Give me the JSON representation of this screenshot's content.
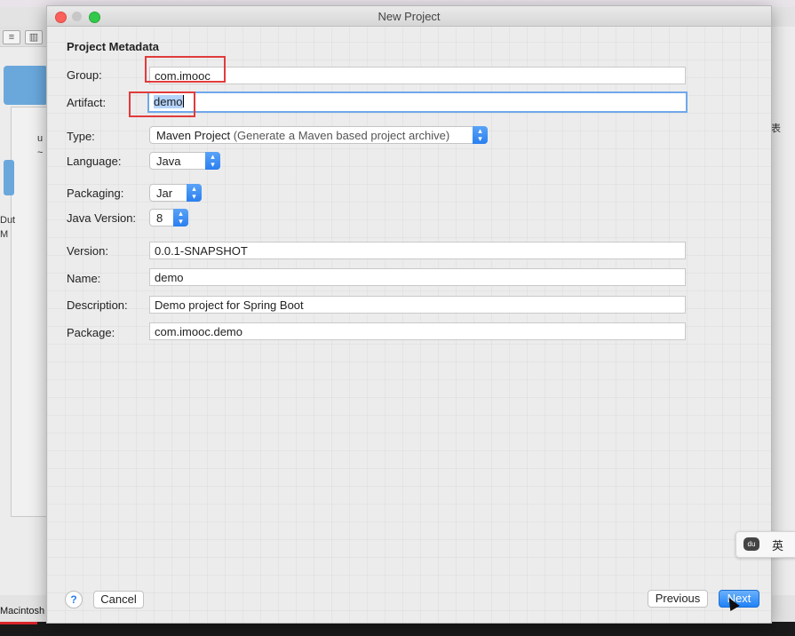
{
  "window": {
    "title": "New Project"
  },
  "section_title": "Project Metadata",
  "fields": {
    "group": {
      "label": "Group:",
      "value": "com.imooc"
    },
    "artifact": {
      "label": "Artifact:",
      "value": "demo"
    },
    "version": {
      "label": "Version:",
      "value": "0.0.1-SNAPSHOT"
    },
    "name": {
      "label": "Name:",
      "value": "demo"
    },
    "description": {
      "label": "Description:",
      "value": "Demo project for Spring Boot"
    },
    "package": {
      "label": "Package:",
      "value": "com.imooc.demo"
    }
  },
  "selects": {
    "type": {
      "label": "Type:",
      "value": "Maven Project",
      "hint": "(Generate a Maven based project archive)"
    },
    "language": {
      "label": "Language:",
      "value": "Java"
    },
    "packaging": {
      "label": "Packaging:",
      "value": "Jar"
    },
    "java_version": {
      "label": "Java Version:",
      "value": "8"
    }
  },
  "buttons": {
    "help": "?",
    "cancel": "Cancel",
    "previous": "Previous",
    "next": "Next"
  },
  "ime": {
    "char": "英",
    "logo": "du"
  },
  "background": {
    "dock_label": "Macintosh",
    "left_text_1": "u",
    "left_text_2": "~",
    "left_text_3": "Dut",
    "left_text_4": "M",
    "right_text": "表"
  },
  "colors": {
    "accent": "#2a7ff0",
    "annotation": "#e13b3b",
    "selection": "#b3d3fb"
  }
}
